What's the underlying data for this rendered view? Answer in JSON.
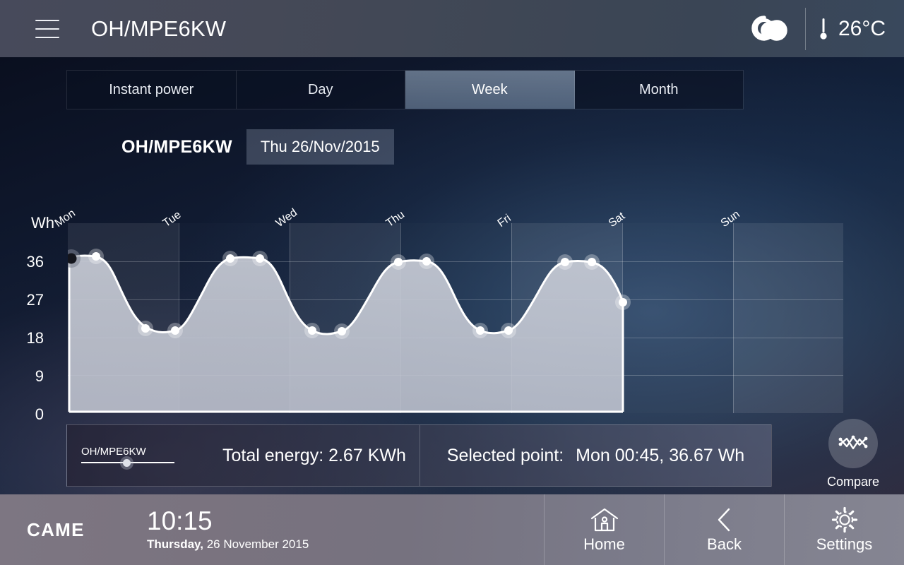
{
  "header": {
    "menu_icon": "hamburger-menu-icon",
    "title": "OH/MPE6KW",
    "weather_icon": "cloud-icon",
    "thermometer_icon": "thermometer-icon",
    "temperature": "26°C"
  },
  "tabs": [
    {
      "label": "Instant power",
      "active": false
    },
    {
      "label": "Day",
      "active": false
    },
    {
      "label": "Week",
      "active": true
    },
    {
      "label": "Month",
      "active": false
    }
  ],
  "selection": {
    "device": "OH/MPE6KW",
    "date": "Thu 26/Nov/2015"
  },
  "info": {
    "legend_label": "OH/MPE6KW",
    "total_energy": "Total energy: 2.67 KWh",
    "selected_point_label": "Selected point:",
    "selected_point_value": "Mon 00:45,  36.67 Wh"
  },
  "compare": {
    "label": "Compare",
    "icon": "compare-chart-icon"
  },
  "footer": {
    "brand": "CAME",
    "time": "10:15",
    "weekday": "Thursday,",
    "date": " 26 November 2015",
    "nav": [
      {
        "label": "Home",
        "icon": "home-icon"
      },
      {
        "label": "Back",
        "icon": "chevron-left-icon"
      },
      {
        "label": "Settings",
        "icon": "gear-icon"
      }
    ]
  },
  "chart_data": {
    "type": "area",
    "title": "",
    "xlabel": "",
    "ylabel": "Wh",
    "ylim": [
      0,
      45
    ],
    "yticks": [
      0,
      9,
      18,
      27,
      36
    ],
    "ytick_labels": [
      "0",
      "9",
      "18",
      "27",
      "36"
    ],
    "categories": [
      "Mon",
      "Tue",
      "Wed",
      "Thu",
      "Fri",
      "Sat",
      "Sun"
    ],
    "grid": true,
    "legend": "OH/MPE6KW",
    "selected_index": 0,
    "selected_label": "Mon 00:45",
    "selected_value": 36.67,
    "series": [
      {
        "name": "OH/MPE6KW",
        "x": [
          0.0,
          0.25,
          0.75,
          1.0,
          1.5,
          1.75,
          2.0,
          2.5,
          2.75,
          3.0,
          3.5,
          3.75,
          4.0
        ],
        "values": [
          36.67,
          36.5,
          25.6,
          22.8,
          37.8,
          37.4,
          25.2,
          22.0,
          34.9,
          35.8,
          24.8,
          22.1,
          34.6
        ]
      }
    ],
    "points_drawn": [
      {
        "x": 0.0,
        "v": 36.67,
        "selected": true
      },
      {
        "x": 0.25,
        "v": 36.5,
        "selected": false
      },
      {
        "x": 0.75,
        "v": 25.6,
        "selected": false
      },
      {
        "x": 1.0,
        "v": 22.8,
        "selected": false
      },
      {
        "x": 1.5,
        "v": 37.8,
        "selected": false
      },
      {
        "x": 1.75,
        "v": 37.4,
        "selected": false
      },
      {
        "x": 2.0,
        "v": 25.2,
        "selected": false
      },
      {
        "x": 2.25,
        "v": 22.0,
        "selected": false
      },
      {
        "x": 2.6,
        "v": 34.9,
        "selected": false
      },
      {
        "x": 2.85,
        "v": 35.8,
        "selected": false
      },
      {
        "x": 3.2,
        "v": 24.8,
        "selected": false
      },
      {
        "x": 3.4,
        "v": 22.1,
        "selected": false
      },
      {
        "x": 3.7,
        "v": 34.6,
        "selected": false
      },
      {
        "x": 3.95,
        "v": 34.9,
        "selected": false
      },
      {
        "x": 4.15,
        "v": 29.3,
        "selected": false
      }
    ]
  }
}
